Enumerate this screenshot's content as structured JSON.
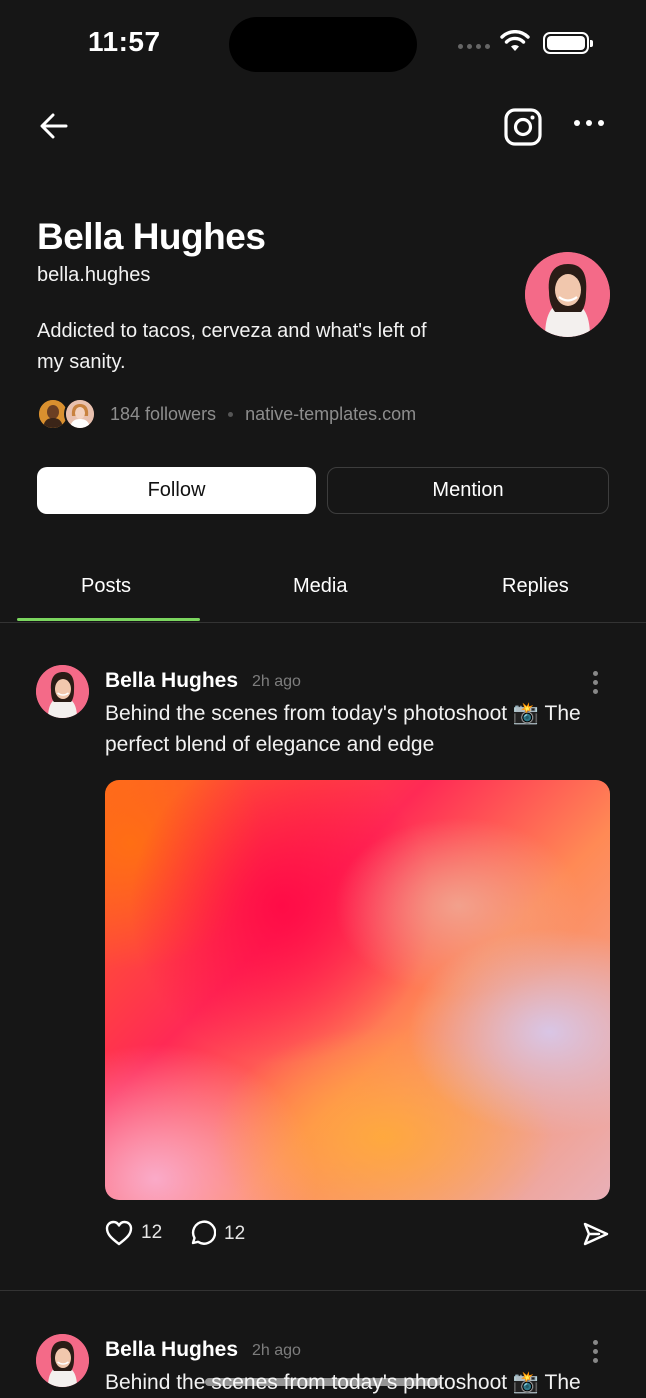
{
  "status_bar": {
    "time": "11:57"
  },
  "profile": {
    "name": "Bella Hughes",
    "handle": "bella.hughes",
    "bio": "Addicted to tacos, cerveza and what's left of my sanity.",
    "followers": "184 followers",
    "website": "native-templates.com"
  },
  "actions": {
    "follow": "Follow",
    "mention": "Mention"
  },
  "tabs": [
    {
      "label": "Posts",
      "active": true
    },
    {
      "label": "Media",
      "active": false
    },
    {
      "label": "Replies",
      "active": false
    }
  ],
  "posts": [
    {
      "author": "Bella Hughes",
      "time": "2h ago",
      "text": "Behind the scenes from today's photoshoot 📸 The perfect blend of elegance and edge",
      "likes": "12",
      "comments": "12"
    },
    {
      "author": "Bella Hughes",
      "time": "2h ago",
      "text": "Behind the scenes from today's photoshoot 📸 The"
    }
  ],
  "colors": {
    "background": "#161616",
    "accent": "#7bd65f"
  },
  "icons": [
    "back-arrow-icon",
    "instagram-icon",
    "more-icon",
    "heart-icon",
    "comment-icon",
    "send-icon",
    "kebab-icon"
  ]
}
